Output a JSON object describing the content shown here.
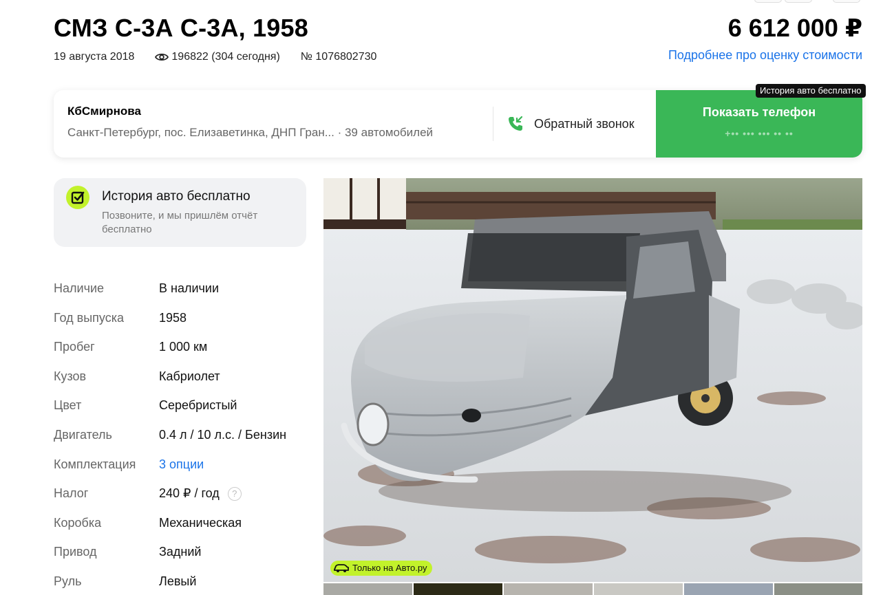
{
  "listing": {
    "title": "СМЗ С-3А С-3А, 1958",
    "date": "19 августа 2018",
    "views": "196822 (304 сегодня)",
    "number": "№ 1076802730",
    "price": "6 612 000 ₽",
    "price_link": "Подробнее про оценку стоимости"
  },
  "seller": {
    "name": "КбСмирнова",
    "address": "Санкт-Петербург, пос. Елизаветинка, ДНП Гран... · 39 автомобилей",
    "callback_label": "Обратный звонок",
    "phone_button": "Показать телефон",
    "phone_masked": "+•• ••• ••• •• ••",
    "history_tag": "История авто бесплатно"
  },
  "history": {
    "title": "История авто бесплатно",
    "subtitle": "Позвоните, и мы пришлём отчёт бесплатно"
  },
  "specs": [
    {
      "label": "Наличие",
      "value": "В наличии"
    },
    {
      "label": "Год выпуска",
      "value": "1958"
    },
    {
      "label": "Пробег",
      "value": "1 000 км"
    },
    {
      "label": "Кузов",
      "value": "Кабриолет"
    },
    {
      "label": "Цвет",
      "value": "Серебристый"
    },
    {
      "label": "Двигатель",
      "value": "0.4 л / 10 л.с. / Бензин"
    },
    {
      "label": "Комплектация",
      "value": "3 опции"
    },
    {
      "label": "Налог",
      "value": "240 ₽ / год"
    },
    {
      "label": "Коробка",
      "value": "Механическая"
    },
    {
      "label": "Привод",
      "value": "Задний"
    },
    {
      "label": "Руль",
      "value": "Левый"
    }
  ],
  "photo": {
    "badge": "Только на Авто.ру",
    "thumb_count": 6
  },
  "colors": {
    "accent_green": "#3ab757",
    "link_blue": "#1a73e8",
    "lime": "#c2f22b"
  },
  "icons": [
    "eye-icon",
    "phone-callback-icon",
    "history-check-icon",
    "car-icon",
    "question-icon"
  ]
}
